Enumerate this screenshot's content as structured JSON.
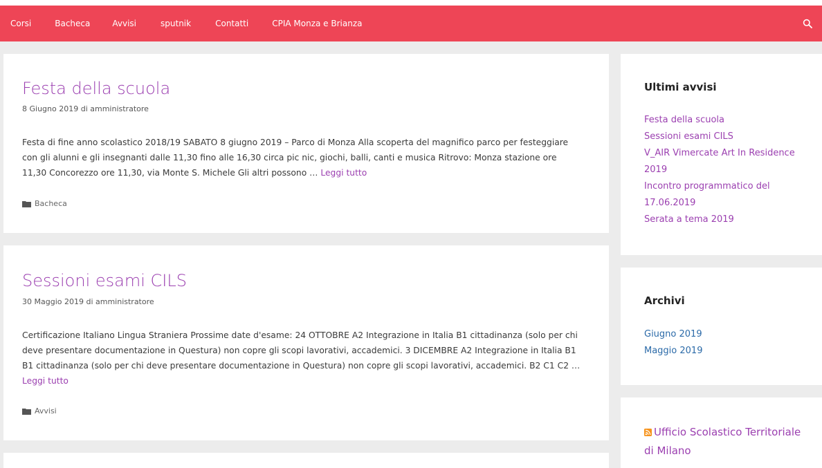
{
  "nav": {
    "items": [
      "Corsi",
      "Bacheca",
      "Avvisi",
      "sputnik",
      "Contatti",
      "CPIA Monza e Brianza"
    ],
    "search_icon": "search-icon",
    "color": "#ee4556"
  },
  "articles": [
    {
      "title": "Festa della scuola",
      "meta": "8 Giugno 2019 di amministratore",
      "excerpt": "Festa di fine anno scolastico 2018/19 SABATO 8 giugno 2019 – Parco di Monza Alla scoperta del magnifico parco per festeggiare con gli alunni e gli insegnanti dalle 11,30 fino alle 16,30 circa pic nic, giochi, balli, canti e musica Ritrovo: Monza stazione ore 11,30 Concorezzo ore 11,30, via Monte S. Michele Gli altri possono … ",
      "read_more": "Leggi tutto",
      "category": "Bacheca"
    },
    {
      "title": "Sessioni esami CILS",
      "meta": "30 Maggio 2019 di amministratore",
      "excerpt": "Certificazione Italiano Lingua Straniera Prossime date d'esame: 24 OTTOBRE A2 Integrazione in Italia B1 cittadinanza (solo per chi deve presentare documentazione in Questura) non copre gli scopi lavorativi, accademici. 3 DICEMBRE A2 Integrazione in Italia B1 B1 cittadinanza (solo per chi deve presentare documentazione in Questura) non copre gli scopi lavorativi, accademici. B2 C1 C2 … ",
      "read_more": "Leggi tutto",
      "category": "Avvisi"
    }
  ],
  "sidebar": {
    "recent": {
      "title": "Ultimi avvisi",
      "items": [
        "Festa della scuola",
        "Sessioni esami CILS",
        "V_AIR Vimercate Art In Residence 2019",
        "Incontro programmatico del 17.06.2019",
        "Serata a tema 2019"
      ]
    },
    "archive": {
      "title": "Archivi",
      "items": [
        "Giugno 2019",
        "Maggio 2019"
      ]
    },
    "rss": {
      "link": "Ufficio Scolastico Territoriale di Milano"
    }
  },
  "colors": {
    "link": "#9b3fb0",
    "archive_link": "#2b6aa8"
  }
}
